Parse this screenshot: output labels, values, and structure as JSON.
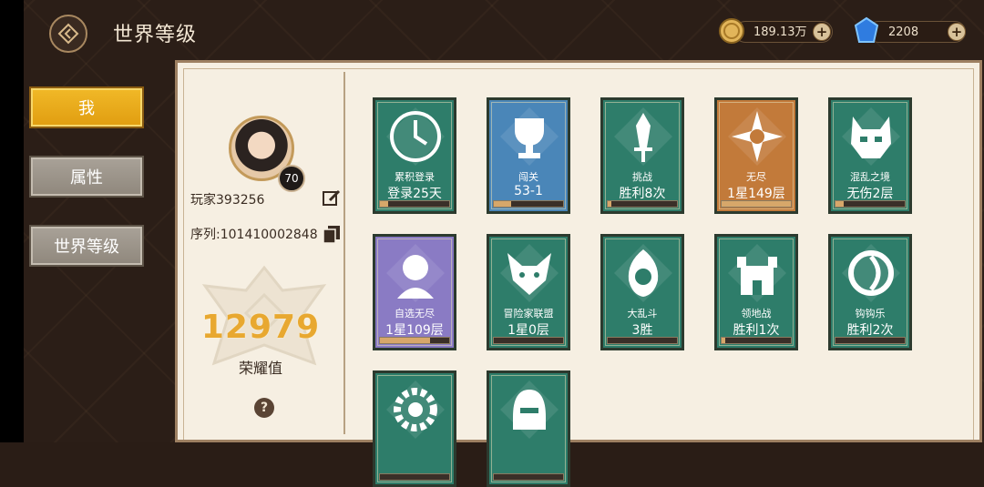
{
  "header": {
    "title": "世界等级",
    "back_icon": "back-arrow-icon"
  },
  "currencies": [
    {
      "icon": "gold-coin-icon",
      "value": "189.13万"
    },
    {
      "icon": "blue-crystal-icon",
      "value": "2208"
    }
  ],
  "sidebar": {
    "items": [
      {
        "label": "我",
        "active": true
      },
      {
        "label": "属性",
        "active": false
      },
      {
        "label": "世界等级",
        "active": false
      }
    ]
  },
  "profile": {
    "level": "70",
    "name": "玩家393256",
    "serial": "序列:101410002848",
    "honor_value": "12979",
    "honor_label": "荣耀值"
  },
  "achievements": [
    {
      "name": "累积登录",
      "value": "登录25天",
      "icon": "clock-icon",
      "color": "#2e7d6a",
      "progress": 0.12
    },
    {
      "name": "闯关",
      "value": "53-1",
      "icon": "trophy-icon",
      "color": "#4a86b8",
      "progress": 0.25
    },
    {
      "name": "挑战",
      "value": "胜利8次",
      "icon": "sword-icon",
      "color": "#2e7d6a",
      "progress": 0.05
    },
    {
      "name": "无尽",
      "value": "1星149层",
      "icon": "star-icon",
      "color": "#c27a3a",
      "progress": 1.0
    },
    {
      "name": "混乱之境",
      "value": "无伤2层",
      "icon": "demon-mask-icon",
      "color": "#2e7d6a",
      "progress": 0.12
    },
    {
      "name": "自选无尽",
      "value": "1星109层",
      "icon": "character-portrait-icon",
      "color": "#8a7bc4",
      "progress": 0.72
    },
    {
      "name": "冒险家联盟",
      "value": "1星0层",
      "icon": "fox-mask-icon",
      "color": "#2e7d6a",
      "progress": 0.0
    },
    {
      "name": "大乱斗",
      "value": "3胜",
      "icon": "flame-shield-icon",
      "color": "#2e7d6a",
      "progress": 0.0
    },
    {
      "name": "领地战",
      "value": "胜利1次",
      "icon": "castle-icon",
      "color": "#2e7d6a",
      "progress": 0.05
    },
    {
      "name": "钩钩乐",
      "value": "胜利2次",
      "icon": "hook-icon",
      "color": "#2e7d6a",
      "progress": 0.0
    },
    {
      "name": "",
      "value": "",
      "icon": "gear-crest-icon",
      "color": "#2e7d6a",
      "progress": 0.0
    },
    {
      "name": "",
      "value": "",
      "icon": "helmet-icon",
      "color": "#2e7d6a",
      "progress": 0.0
    }
  ]
}
